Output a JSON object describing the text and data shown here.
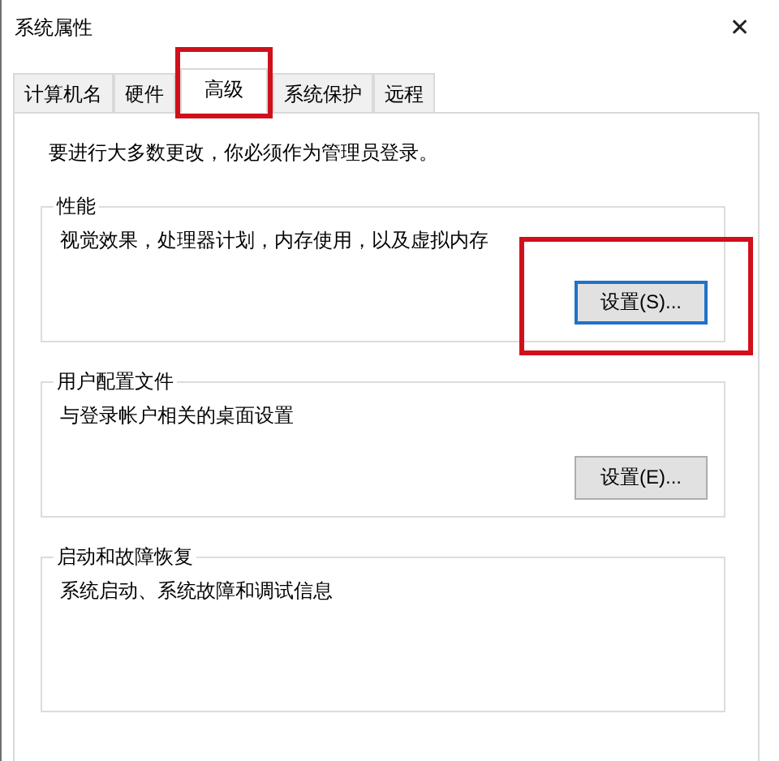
{
  "window": {
    "title": "系统属性",
    "close": "✕"
  },
  "tabs": [
    {
      "label": "计算机名",
      "selected": false,
      "highlighted": false
    },
    {
      "label": "硬件",
      "selected": false,
      "highlighted": false
    },
    {
      "label": "高级",
      "selected": true,
      "highlighted": true
    },
    {
      "label": "系统保护",
      "selected": false,
      "highlighted": false
    },
    {
      "label": "远程",
      "selected": false,
      "highlighted": false
    }
  ],
  "notice": "要进行大多数更改，你必须作为管理员登录。",
  "groups": [
    {
      "title": "性能",
      "description": "视觉效果，处理器计划，内存使用，以及虚拟内存",
      "button": {
        "label": "设置(S)...",
        "focused": true,
        "highlighted": true
      }
    },
    {
      "title": "用户配置文件",
      "description": "与登录帐户相关的桌面设置",
      "button": {
        "label": "设置(E)...",
        "focused": false,
        "highlighted": false
      }
    },
    {
      "title": "启动和故障恢复",
      "description": "系统启动、系统故障和调试信息"
    }
  ]
}
